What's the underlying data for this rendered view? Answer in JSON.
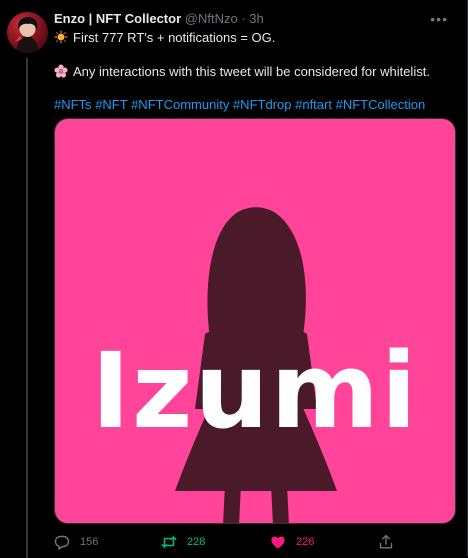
{
  "tweet": {
    "display_name": "Enzo | NFT Collector",
    "handle": "@NftNzo",
    "separator": "·",
    "time": "3h",
    "more_icon": "more-icon",
    "line1": "First 777 RT's + notifications = OG.",
    "line1_icon": "sun-emoji-icon",
    "line2": "Any interactions with this tweet will be considered for whitelist.",
    "line2_icon": "blossom-emoji-icon",
    "hashtags": [
      "#NFTs",
      "#NFT",
      "#NFTCommunity",
      "#NFTdrop",
      "#nftart",
      "#NFTCollection"
    ],
    "media_title": "Izumi",
    "media_background": "#ff4499",
    "media_silhouette": "#4a1a2a"
  },
  "actions": {
    "reply_count": "156",
    "retweet_count": "228",
    "like_count": "226",
    "reply_icon": "reply-icon",
    "retweet_icon": "retweet-icon",
    "like_icon": "heart-icon",
    "share_icon": "share-icon",
    "retweet_color": "#00ba7c",
    "like_color": "#f91880"
  },
  "colors": {
    "background": "#000000",
    "text": "#e7e9ea",
    "muted": "#71767b",
    "link": "#1d9bf0"
  }
}
